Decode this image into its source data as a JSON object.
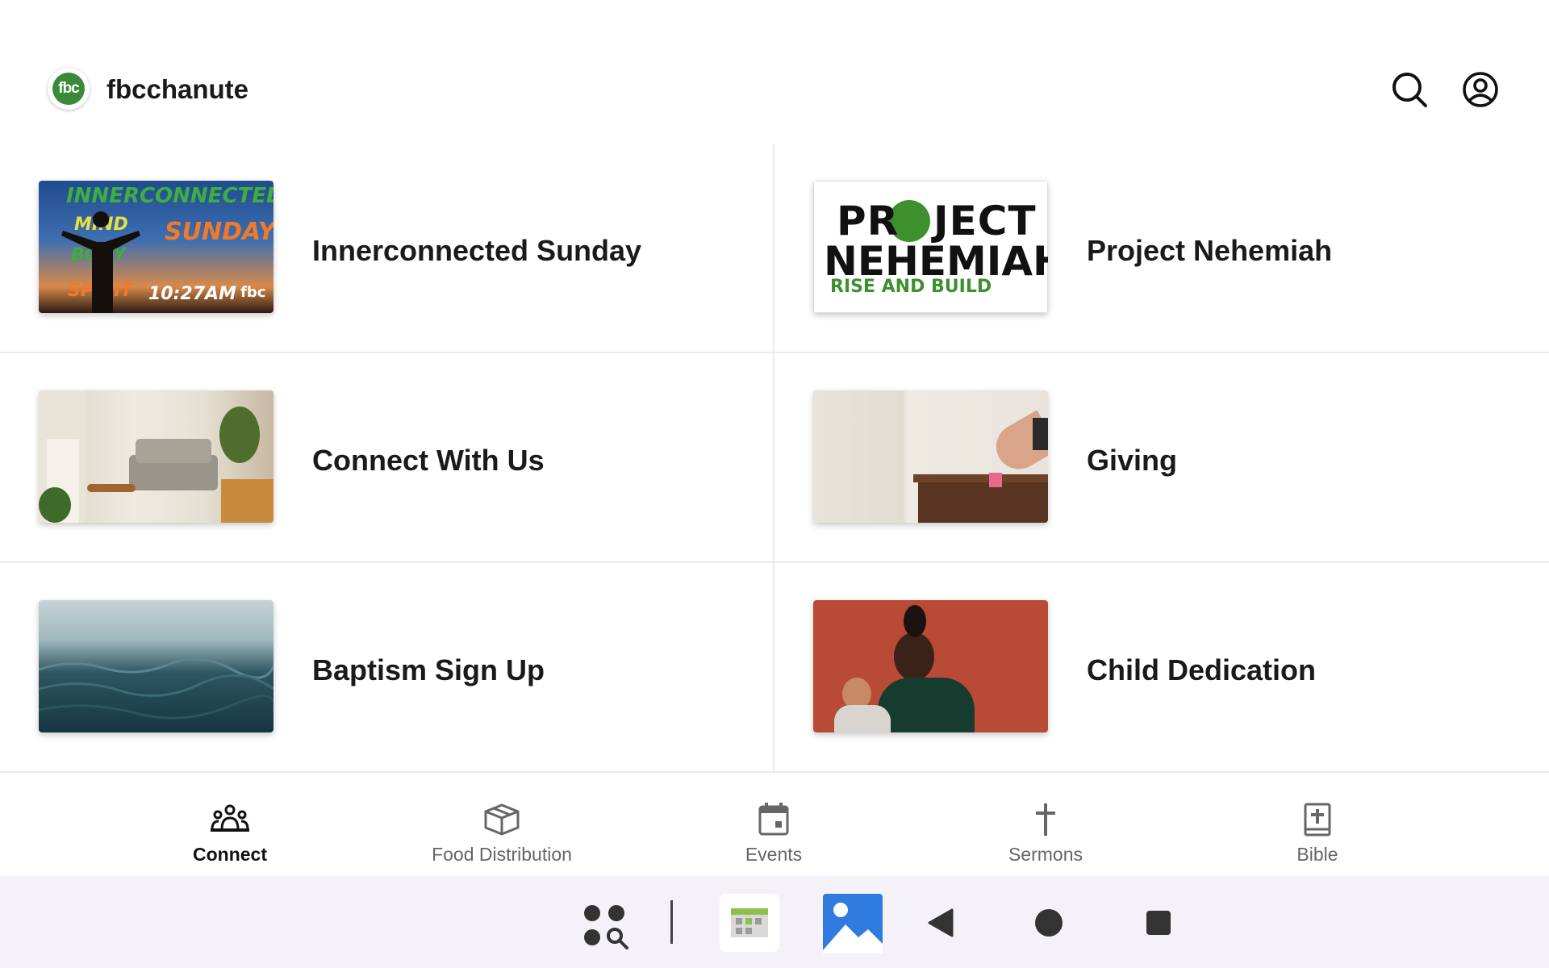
{
  "header": {
    "logo_text": "fbc",
    "app_title": "fbcchanute"
  },
  "cards": [
    {
      "label": "Innerconnected Sunday",
      "thumb_words": [
        "INNERCONNECTED",
        "MIND",
        "SUNDAY",
        "BODY",
        "SPIRIT",
        "10:27AM",
        "fbc"
      ]
    },
    {
      "label": "Project Nehemiah",
      "thumb_words": [
        "PR",
        "JECT",
        "NEHEMIAH",
        "RISE AND BUILD"
      ]
    },
    {
      "label": "Connect With Us"
    },
    {
      "label": "Giving"
    },
    {
      "label": "Baptism Sign Up"
    },
    {
      "label": "Child Dedication"
    }
  ],
  "nav": {
    "items": [
      {
        "label": "Connect",
        "icon": "people-icon",
        "active": true
      },
      {
        "label": "Food Distribution",
        "icon": "box-icon",
        "active": false
      },
      {
        "label": "Events",
        "icon": "calendar-icon",
        "active": false
      },
      {
        "label": "Sermons",
        "icon": "cross-icon",
        "active": false
      },
      {
        "label": "Bible",
        "icon": "bible-icon",
        "active": false
      }
    ]
  },
  "system_bar": {
    "icons": [
      "app-drawer-search-icon",
      "calendar-app-icon",
      "gallery-app-icon",
      "back-icon",
      "home-icon",
      "recents-icon"
    ]
  },
  "colors": {
    "brand_green": "#3a8a3a",
    "active_nav": "#111111",
    "inactive_nav": "#666666"
  }
}
